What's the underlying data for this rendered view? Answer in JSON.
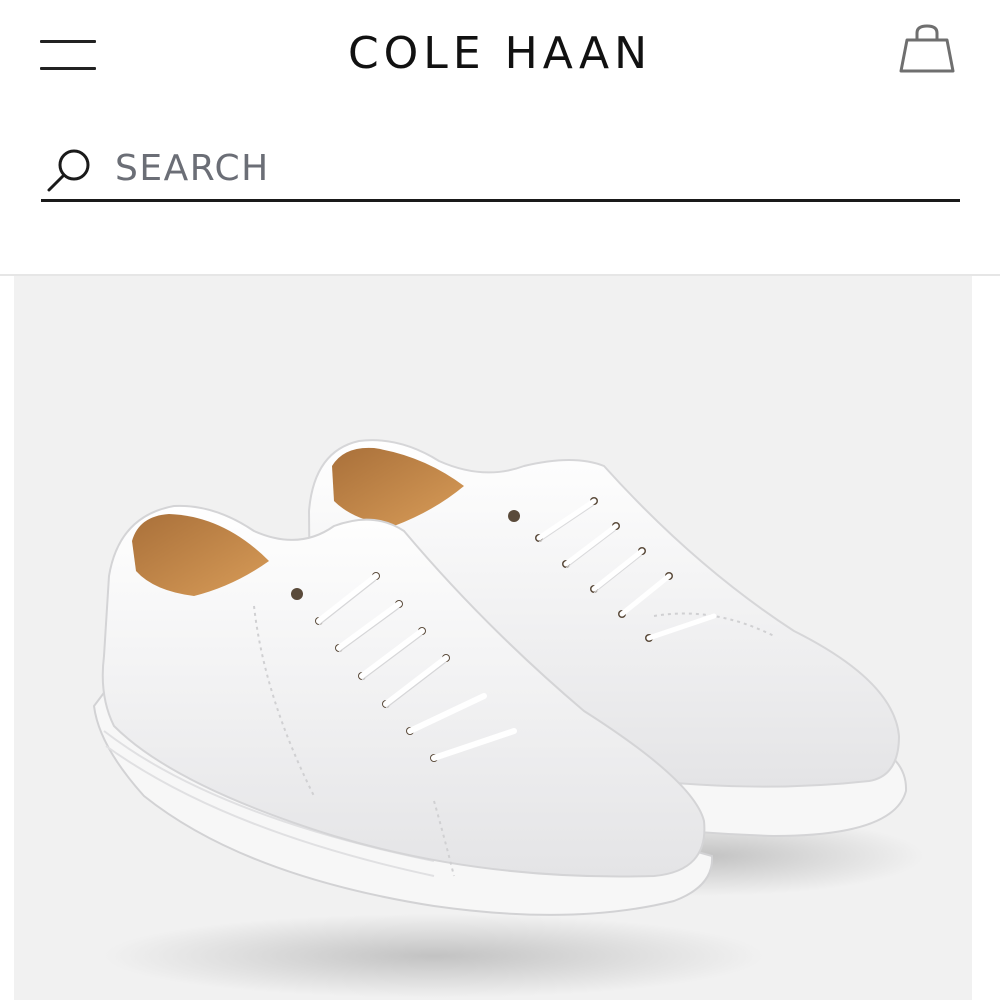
{
  "header": {
    "menu_icon": "hamburger-menu-icon",
    "brand": "COLE HAAN",
    "bag_icon": "shopping-bag-icon"
  },
  "search": {
    "icon": "search-icon",
    "placeholder": "SEARCH",
    "value": ""
  },
  "product": {
    "image": "white-leather-sneakers-pair"
  },
  "colors": {
    "background": "#ffffff",
    "divider": "#e6e6e6",
    "text": "#111111",
    "placeholder": "#6b6e76",
    "image_bg": "#f1f1f1",
    "shoe_lining": "#c98a45"
  }
}
